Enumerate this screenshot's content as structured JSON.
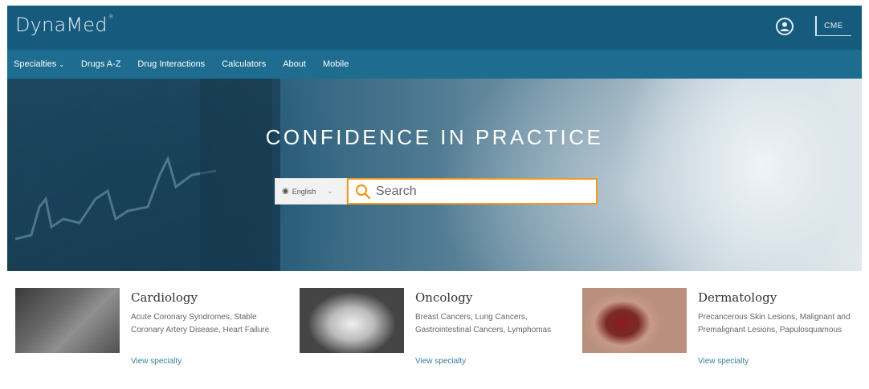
{
  "header": {
    "logo": "DynaMed",
    "logo_mark": "®",
    "cme_label": "CME"
  },
  "nav": {
    "items": [
      {
        "label": "Specialties",
        "has_dropdown": true
      },
      {
        "label": "Drugs A-Z"
      },
      {
        "label": "Drug Interactions"
      },
      {
        "label": "Calculators"
      },
      {
        "label": "About"
      },
      {
        "label": "Mobile"
      }
    ]
  },
  "hero": {
    "title": "CONFIDENCE IN PRACTICE",
    "language_selected": "English",
    "search_placeholder": "Search"
  },
  "specialties": [
    {
      "name": "Cardiology",
      "description": "Acute Coronary Syndromes, Stable Coronary Artery Disease, Heart Failure",
      "link": "View specialty"
    },
    {
      "name": "Oncology",
      "description": "Breast Cancers, Lung Cancers, Gastrointestinal Cancers, Lymphomas",
      "link": "View specialty"
    },
    {
      "name": "Dermatology",
      "description": "Precancerous Skin Lesions, Malignant and Premalignant Lesions, Papulosquamous",
      "link": "View specialty"
    }
  ],
  "colors": {
    "header": "#165a7d",
    "nav": "#1e6c8f",
    "search_border": "#f29a1e",
    "link": "#3c7da0"
  }
}
